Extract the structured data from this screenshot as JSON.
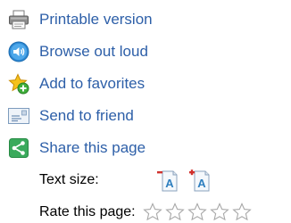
{
  "tools": {
    "items": [
      {
        "id": "printable",
        "label": "Printable version",
        "icon": "printer-icon"
      },
      {
        "id": "browse-aloud",
        "label": "Browse out loud",
        "icon": "speaker-icon"
      },
      {
        "id": "favorites",
        "label": "Add to favorites",
        "icon": "star-add-icon"
      },
      {
        "id": "send-friend",
        "label": "Send to friend",
        "icon": "envelope-icon"
      },
      {
        "id": "share",
        "label": "Share this page",
        "icon": "share-icon"
      }
    ],
    "link_color": "#2d5fa8"
  },
  "text_size": {
    "label": "Text size:",
    "decrease_icon": "text-size-decrease-icon",
    "increase_icon": "text-size-increase-icon"
  },
  "rating": {
    "label": "Rate this page:",
    "max_stars": 5,
    "current": 0
  }
}
